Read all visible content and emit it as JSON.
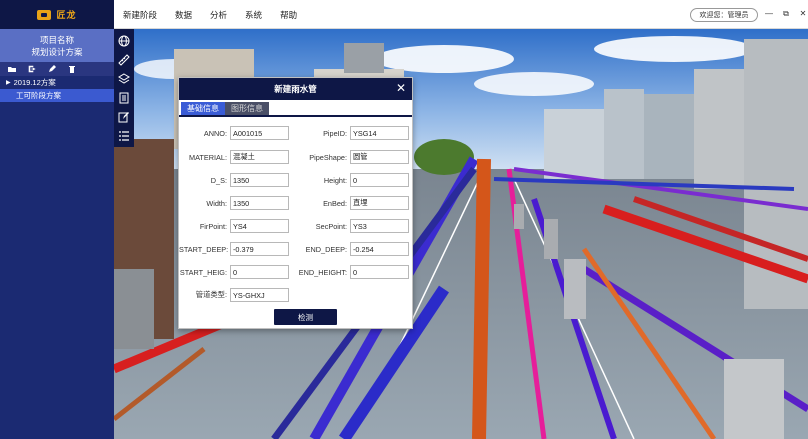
{
  "app": {
    "logo_text": "匠龙",
    "menu": [
      "新建阶段",
      "数据",
      "分析",
      "系统",
      "帮助"
    ],
    "user_label": "欢迎您：管理员",
    "window_controls": [
      "—",
      "⧉",
      "✕"
    ]
  },
  "sidebar": {
    "project_title": "项目名称",
    "project_subtitle": "规划设计方案",
    "tools": [
      "folder-open-icon",
      "export-icon",
      "edit-icon",
      "delete-icon"
    ],
    "tree": [
      {
        "label": "2019.12方案",
        "expanded": true
      },
      {
        "label": "工可阶段方案",
        "selected": true
      }
    ]
  },
  "vtoolbar": [
    "globe-icon",
    "ruler-icon",
    "layers-icon",
    "document-icon",
    "edit-box-icon",
    "list-icon"
  ],
  "dialog": {
    "title": "新建雨水管",
    "close": "✕",
    "tabs": [
      "基础信息",
      "图形信息"
    ],
    "fields_left": [
      {
        "label": "ANNO:",
        "value": "A001015"
      },
      {
        "label": "MATERIAL:",
        "value": "混凝土"
      },
      {
        "label": "D_S:",
        "value": "1350"
      },
      {
        "label": "Width:",
        "value": "1350"
      },
      {
        "label": "FirPoint:",
        "value": "YS4"
      },
      {
        "label": "START_DEEP:",
        "value": "-0.379"
      },
      {
        "label": "START_HEIG:",
        "value": "0"
      },
      {
        "label": "管道类型:",
        "value": "YS-GHXJ"
      }
    ],
    "fields_right": [
      {
        "label": "PipeID:",
        "value": "YSG14"
      },
      {
        "label": "PipeShape:",
        "value": "圆管"
      },
      {
        "label": "Height:",
        "value": "0"
      },
      {
        "label": "EnBed:",
        "value": "直埋"
      },
      {
        "label": "SecPoint:",
        "value": "YS3"
      },
      {
        "label": "END_DEEP:",
        "value": "-0.254"
      },
      {
        "label": "END_HEIGHT:",
        "value": "0"
      }
    ],
    "button": "检测"
  },
  "colors": {
    "navy": "#0e1746",
    "sidebar": "#1b2a72",
    "accent_blue": "#3a5cd6",
    "logo_gold": "#e8a317"
  }
}
